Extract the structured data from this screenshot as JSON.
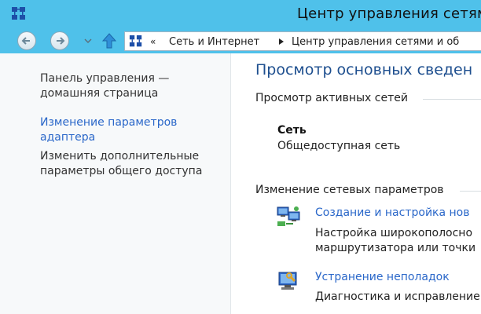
{
  "window": {
    "title": "Центр управления сетям"
  },
  "address_bar": {
    "overflow": "«",
    "crumbs": [
      "Сеть и Интернет",
      "Центр управления сетями и об"
    ]
  },
  "left_pane": {
    "home_link": [
      "Панель управления —",
      "домашняя страница"
    ],
    "adapter_link": [
      "Изменение параметров",
      "адаптера"
    ],
    "sharing_link": [
      "Изменить дополнительные",
      "параметры общего доступа"
    ]
  },
  "main": {
    "page_title": "Просмотр основных сведен",
    "active_networks_heading": "Просмотр активных сетей",
    "network": {
      "name": "Сеть",
      "type": "Общедоступная сеть"
    },
    "change_settings_heading": "Изменение сетевых параметров",
    "tasks": [
      {
        "link": "Создание и настройка нов",
        "desc": [
          "Настройка широкополосно",
          "маршрутизатора или точки"
        ],
        "icon": "network-setup-icon"
      },
      {
        "link": "Устранение неполадок",
        "desc": [
          "Диагностика и исправление"
        ],
        "icon": "troubleshoot-icon"
      }
    ]
  },
  "colors": {
    "titlebar": "#4fc1ea",
    "link": "#2a67c9",
    "heading": "#1e4f8f"
  }
}
